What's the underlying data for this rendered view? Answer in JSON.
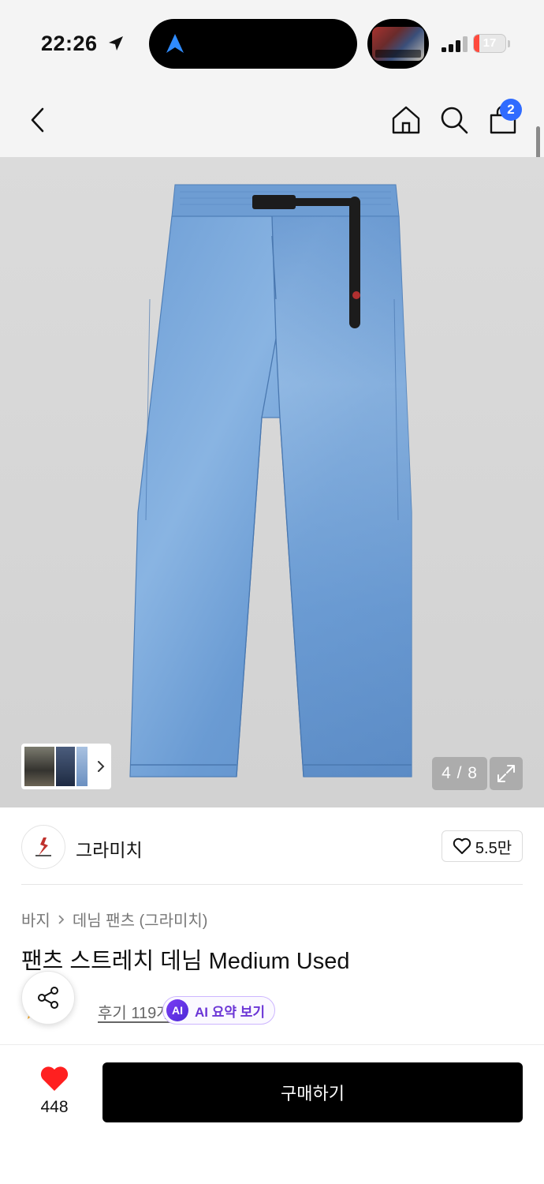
{
  "status_bar": {
    "time": "22:26",
    "battery_level": "17",
    "battery_fraction": 0.17,
    "icons": [
      "location-arrow-icon",
      "navigation-icon",
      "signal-icon",
      "battery-icon"
    ]
  },
  "nav": {
    "cart_count": "2",
    "icons": [
      "back-icon",
      "home-icon",
      "search-icon",
      "cart-icon"
    ]
  },
  "gallery": {
    "counter": "4 / 8"
  },
  "brand": {
    "name": "그라미치",
    "likes": "5.5만"
  },
  "product": {
    "breadcrumb": [
      "바지",
      "데님 팬츠 (그라미치)"
    ],
    "title": "팬츠 스트레치 데님 Medium Used",
    "review_count": "후기 119개",
    "ai_badge": "AI",
    "ai_summary": "AI 요약 보기"
  },
  "bottom_bar": {
    "wish_count": "448",
    "buy_label": "구매하기"
  },
  "colors": {
    "accent_blue": "#2f6bff",
    "heart_red": "#ff2020",
    "ai_purple": "#6b35d6",
    "buy_button": "#000000"
  }
}
